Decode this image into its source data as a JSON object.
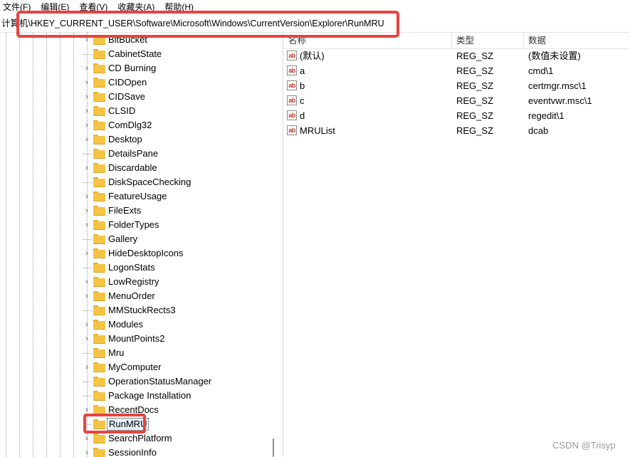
{
  "menu": {
    "items": [
      "文件(F)",
      "编辑(E)",
      "查看(V)",
      "收藏夹(A)",
      "帮助(H)"
    ]
  },
  "address": {
    "path": "计算机\\HKEY_CURRENT_USER\\Software\\Microsoft\\Windows\\CurrentVersion\\Explorer\\RunMRU"
  },
  "tree": {
    "items": [
      {
        "label": "BitBucket",
        "expandable": true
      },
      {
        "label": "CabinetState",
        "expandable": false
      },
      {
        "label": "CD Burning",
        "expandable": true
      },
      {
        "label": "CIDOpen",
        "expandable": true
      },
      {
        "label": "CIDSave",
        "expandable": true
      },
      {
        "label": "CLSID",
        "expandable": true
      },
      {
        "label": "ComDlg32",
        "expandable": true
      },
      {
        "label": "Desktop",
        "expandable": true
      },
      {
        "label": "DetailsPane",
        "expandable": false
      },
      {
        "label": "Discardable",
        "expandable": true
      },
      {
        "label": "DiskSpaceChecking",
        "expandable": false
      },
      {
        "label": "FeatureUsage",
        "expandable": true
      },
      {
        "label": "FileExts",
        "expandable": true
      },
      {
        "label": "FolderTypes",
        "expandable": true
      },
      {
        "label": "Gallery",
        "expandable": false
      },
      {
        "label": "HideDesktopIcons",
        "expandable": true
      },
      {
        "label": "LogonStats",
        "expandable": false
      },
      {
        "label": "LowRegistry",
        "expandable": true
      },
      {
        "label": "MenuOrder",
        "expandable": true
      },
      {
        "label": "MMStuckRects3",
        "expandable": false
      },
      {
        "label": "Modules",
        "expandable": true
      },
      {
        "label": "MountPoints2",
        "expandable": true
      },
      {
        "label": "Mru",
        "expandable": false
      },
      {
        "label": "MyComputer",
        "expandable": true
      },
      {
        "label": "OperationStatusManager",
        "expandable": false
      },
      {
        "label": "Package Installation",
        "expandable": false
      },
      {
        "label": "RecentDocs",
        "expandable": true
      },
      {
        "label": "RunMRU",
        "expandable": false,
        "selected": true
      },
      {
        "label": "SearchPlatform",
        "expandable": true
      },
      {
        "label": "SessionInfo",
        "expandable": true
      }
    ]
  },
  "list": {
    "columns": {
      "name": "名称",
      "type": "类型",
      "data": "数据"
    },
    "rows": [
      {
        "name": "(默认)",
        "type": "REG_SZ",
        "data": "(数值未设置)"
      },
      {
        "name": "a",
        "type": "REG_SZ",
        "data": "cmd\\1"
      },
      {
        "name": "b",
        "type": "REG_SZ",
        "data": "certmgr.msc\\1"
      },
      {
        "name": "c",
        "type": "REG_SZ",
        "data": "eventvwr.msc\\1"
      },
      {
        "name": "d",
        "type": "REG_SZ",
        "data": "regedit\\1"
      },
      {
        "name": "MRUList",
        "type": "REG_SZ",
        "data": "dcab"
      }
    ]
  },
  "icons": {
    "string_value": "ab-string-value-icon",
    "folder": "folder-icon",
    "expander": "chevron-right-icon",
    "string_icon_text": "ab"
  },
  "colors": {
    "highlight": "#e8433f",
    "folder": "#f6c444"
  },
  "watermark": "CSDN @Trisyp"
}
